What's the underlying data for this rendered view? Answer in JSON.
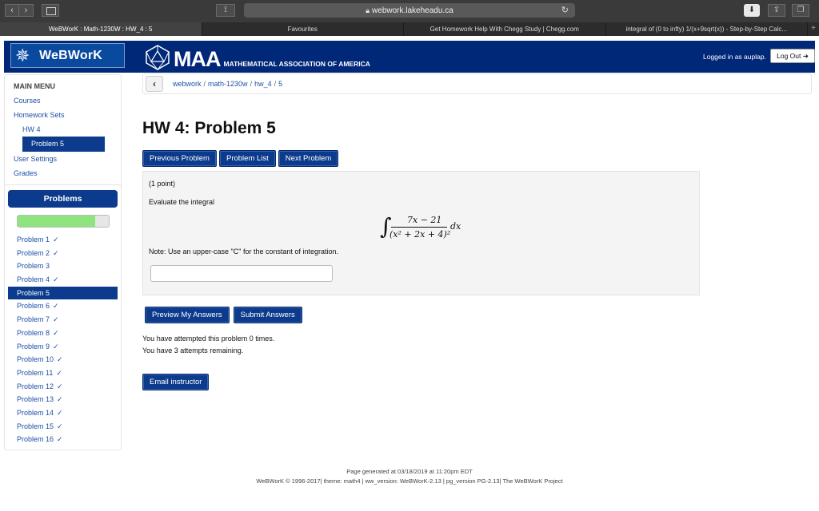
{
  "browser": {
    "url": "webwork.lakeheadu.ca",
    "tabs": [
      "WeBWorK : Math-1230W : HW_4 : 5",
      "Favourites",
      "Get Homework Help With Chegg Study | Chegg.com",
      "integral of (0 to infty) 1/(x+9sqrt(x)) - Step-by-Step Calc..."
    ]
  },
  "header": {
    "brand": "WeBWorK",
    "maa_big": "MAA",
    "maa_small": "MATHEMATICAL ASSOCIATION OF AMERICA",
    "logged_in": "Logged in as auplap.",
    "logout": "Log Out"
  },
  "menu": {
    "title": "MAIN MENU",
    "courses": "Courses",
    "homework_sets": "Homework Sets",
    "hw4": "HW 4",
    "problem5": "Problem 5",
    "user_settings": "User Settings",
    "grades": "Grades"
  },
  "problems_panel": {
    "title": "Problems",
    "progress_fraction": 0.85,
    "items": [
      {
        "label": "Problem 1",
        "check": "✓"
      },
      {
        "label": "Problem 2",
        "check": "✓"
      },
      {
        "label": "Problem 3",
        "check": ""
      },
      {
        "label": "Problem 4",
        "check": "✓"
      },
      {
        "label": "Problem 5",
        "check": "",
        "current": true
      },
      {
        "label": "Problem 6",
        "check": "✓"
      },
      {
        "label": "Problem 7",
        "check": "✓"
      },
      {
        "label": "Problem 8",
        "check": "✓"
      },
      {
        "label": "Problem 9",
        "check": "✓"
      },
      {
        "label": "Problem 10",
        "check": "✓"
      },
      {
        "label": "Problem 11",
        "check": "✓"
      },
      {
        "label": "Problem 12",
        "check": "✓"
      },
      {
        "label": "Problem 13",
        "check": "✓"
      },
      {
        "label": "Problem 14",
        "check": "✓"
      },
      {
        "label": "Problem 15",
        "check": "✓"
      },
      {
        "label": "Problem 16",
        "check": "✓"
      }
    ]
  },
  "breadcrumb": {
    "webwork": "webwork",
    "course": "math-1230w",
    "set": "hw_4",
    "problem": "5"
  },
  "main": {
    "title": "HW 4: Problem 5",
    "prev": "Previous Problem",
    "list": "Problem List",
    "next": "Next Problem",
    "points": "(1 point)",
    "evaluate": "Evaluate the integral",
    "integral": {
      "numerator": "7x − 21",
      "denominator": "(x² + 2x + 4)²",
      "dx": "dx"
    },
    "note": "Note: Use an upper-case \"C\" for the constant of integration.",
    "answer_value": "",
    "preview": "Preview My Answers",
    "submit": "Submit Answers",
    "attempted": "You have attempted this problem 0 times.",
    "remaining": "You have 3 attempts remaining.",
    "email": "Email instructor"
  },
  "footer": {
    "generated": "Page generated at 03/18/2019 at 11:20pm EDT",
    "credits": "WeBWorK © 1996-2017| theme: math4 | ww_version: WeBWorK-2.13 | pg_version PG-2.13| The WeBWorK Project"
  }
}
